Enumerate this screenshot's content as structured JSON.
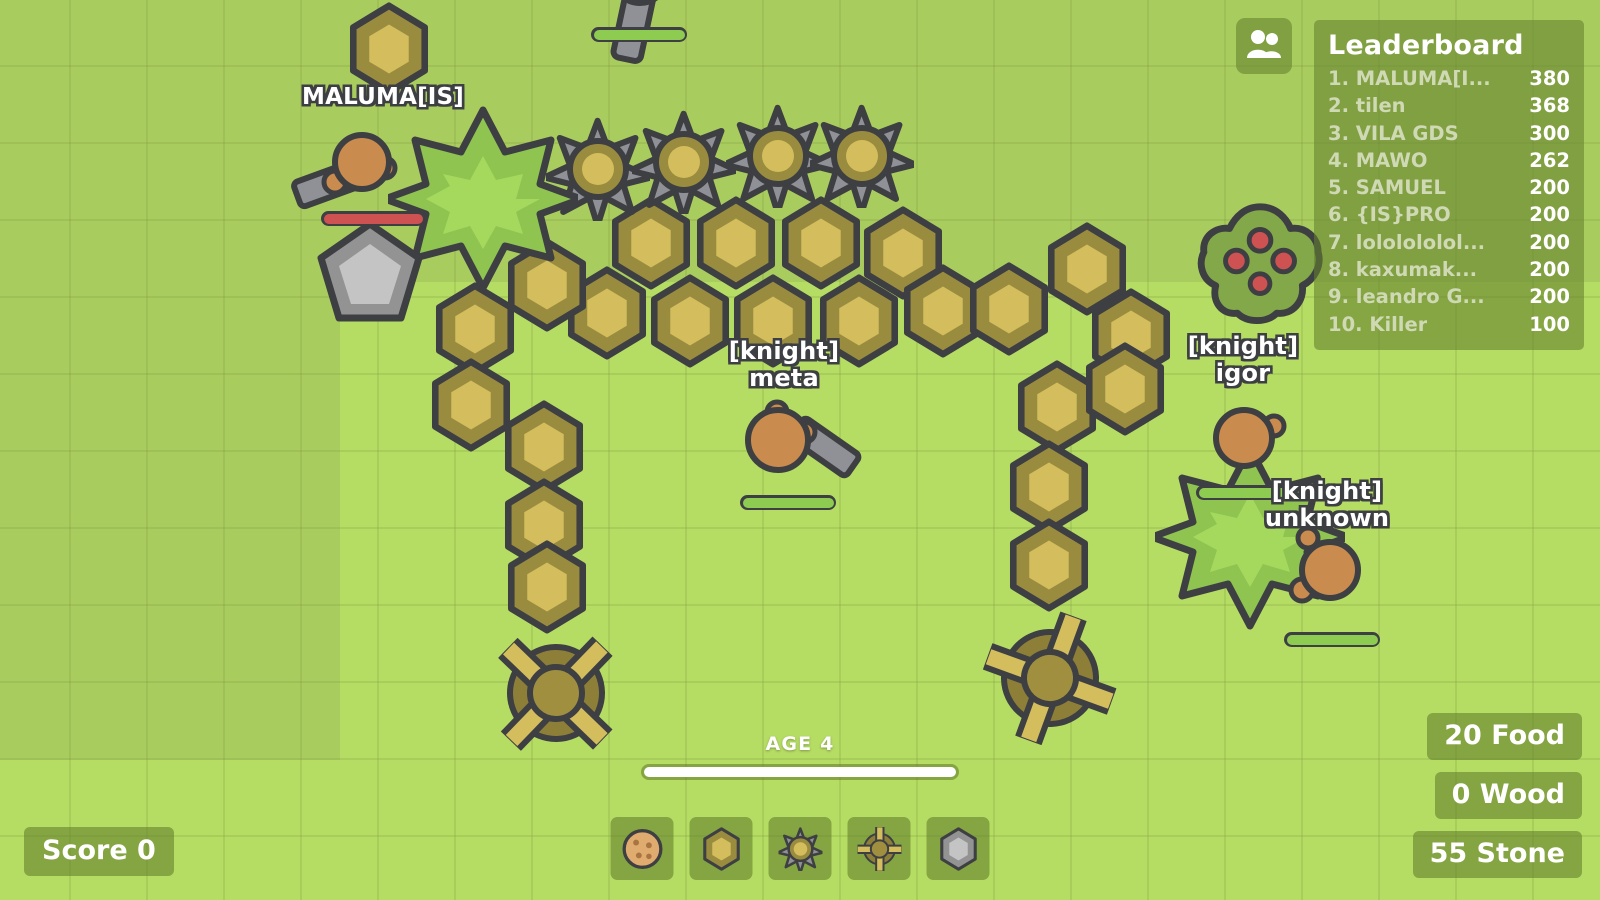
{
  "game": {
    "title": "MooMoo.io",
    "background_color": "#a9cc5e",
    "biome_color": "#b5dc63",
    "outline_color": "#3d3f42"
  },
  "hud": {
    "score": {
      "label": "Score 0",
      "value": 0
    },
    "resources": [
      {
        "name": "food",
        "label": "20 Food",
        "value": 20
      },
      {
        "name": "wood",
        "label": "0 Wood",
        "value": 0
      },
      {
        "name": "stone",
        "label": "55 Stone",
        "value": 55
      }
    ],
    "age": {
      "label": "AGE 4",
      "value": 4,
      "progress_percent": 100
    },
    "players_button_icon": "people-icon",
    "hotbar": [
      {
        "name": "food-cookie",
        "icon": "cookie-icon"
      },
      {
        "name": "wood-wall",
        "icon": "hexagon-wall-icon"
      },
      {
        "name": "spike-trap",
        "icon": "spike-star-icon"
      },
      {
        "name": "windmill",
        "icon": "windmill-icon"
      },
      {
        "name": "stone-wall",
        "icon": "stone-hexagon-icon"
      }
    ]
  },
  "leaderboard": {
    "title": "Leaderboard",
    "rows": [
      {
        "rank": "1.",
        "name": "MALUMA[I...",
        "score": "380"
      },
      {
        "rank": "2.",
        "name": "tilen",
        "score": "368"
      },
      {
        "rank": "3.",
        "name": "VILA GDS",
        "score": "300"
      },
      {
        "rank": "4.",
        "name": "MAWO",
        "score": "262"
      },
      {
        "rank": "5.",
        "name": "SAMUEL",
        "score": "200"
      },
      {
        "rank": "6.",
        "name": "{IS}PRO",
        "score": "200"
      },
      {
        "rank": "7.",
        "name": "lololololol...",
        "score": "200"
      },
      {
        "rank": "8.",
        "name": "kaxumak...",
        "score": "200"
      },
      {
        "rank": "9.",
        "name": "leandro G...",
        "score": "200"
      },
      {
        "rank": "10.",
        "name": "Killer",
        "score": "100"
      }
    ]
  },
  "players": [
    {
      "name": "MALUMA[IS]",
      "line1": "MALUMA[IS]",
      "line2": "",
      "health_percent": 100,
      "health_color": "#cf5252"
    },
    {
      "name": "[knight] meta",
      "line1": "[knight]",
      "line2": "meta",
      "health_percent": 100,
      "health_color": "#8ecc51"
    },
    {
      "name": "[knight] igor",
      "line1": "[knight]",
      "line2": "igor",
      "health_percent": 100,
      "health_color": "#8ecc51"
    },
    {
      "name": "[knight] unknown",
      "line1": "[knight]",
      "line2": "unknown",
      "health_percent": 100,
      "health_color": "#8ecc51"
    }
  ]
}
